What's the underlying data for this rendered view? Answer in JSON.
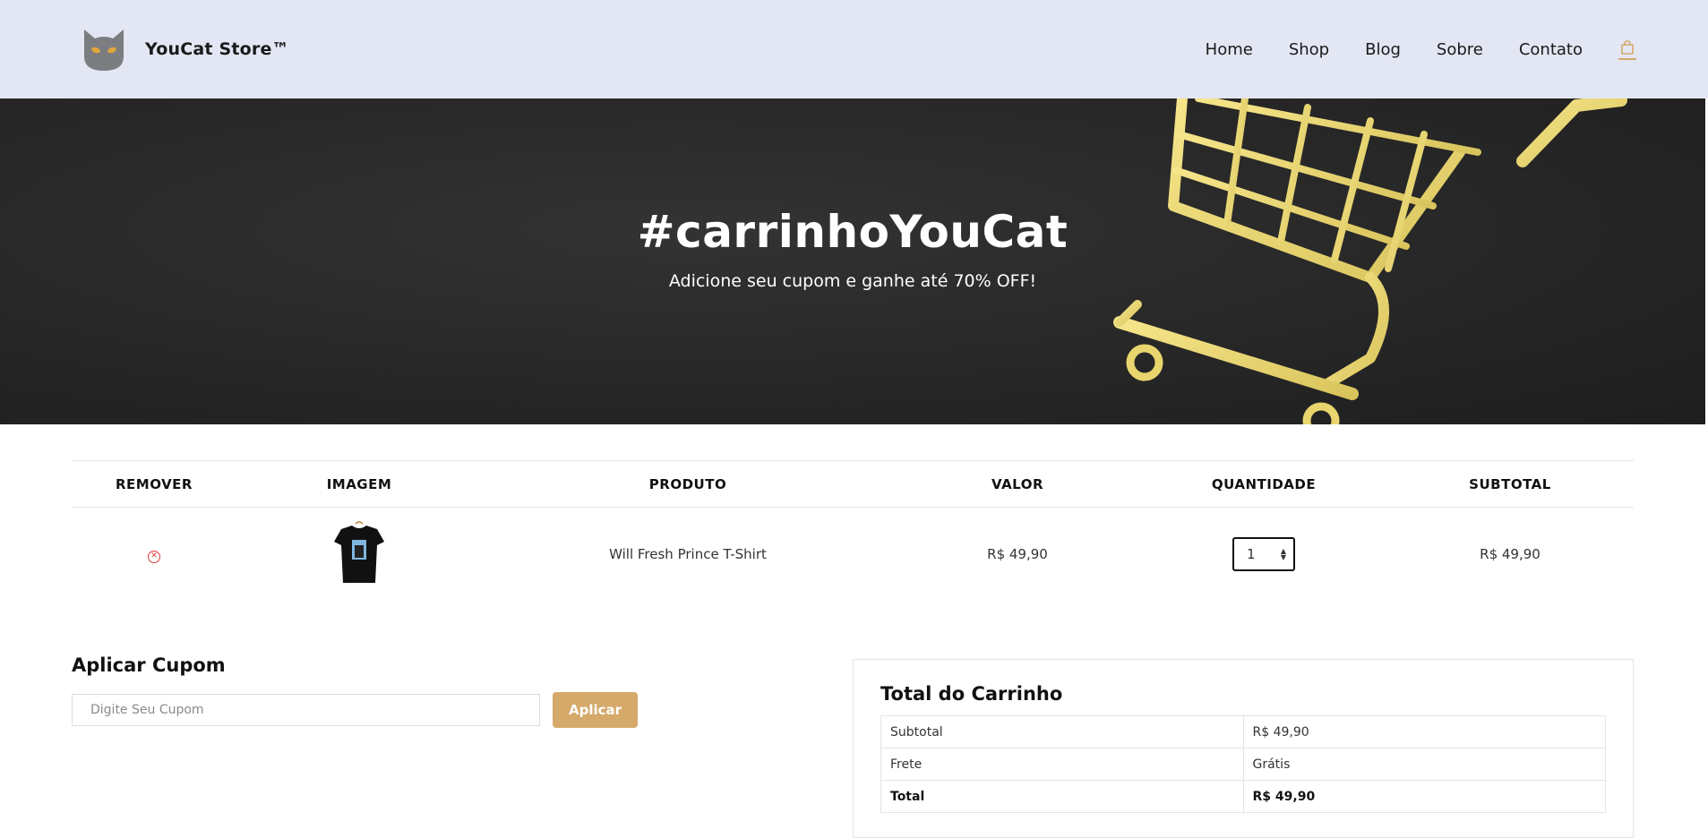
{
  "header": {
    "brand": "YouCat Store™",
    "nav": [
      "Home",
      "Shop",
      "Blog",
      "Sobre",
      "Contato"
    ],
    "cart_icon": "shopping-bag-icon",
    "accent_color": "#d4a96a"
  },
  "hero": {
    "title": "#carrinhoYouCat",
    "subtitle": "Adicione seu cupom e ganhe até 70% OFF!"
  },
  "cart": {
    "headers": [
      "REMOVER",
      "IMAGEM",
      "PRODUTO",
      "VALOR",
      "QUANTIDADE",
      "SUBTOTAL"
    ],
    "rows": [
      {
        "product": "Will Fresh Prince T-Shirt",
        "price": "R$ 49,90",
        "quantity": "1",
        "subtotal": "R$ 49,90"
      }
    ]
  },
  "coupon": {
    "title": "Aplicar Cupom",
    "placeholder": "Digite Seu Cupom",
    "button": "Aplicar"
  },
  "totals": {
    "title": "Total do Carrinho",
    "rows": [
      {
        "label": "Subtotal",
        "value": "R$ 49,90"
      },
      {
        "label": "Frete",
        "value": "Grátis"
      },
      {
        "label": "Total",
        "value": "R$ 49,90"
      }
    ]
  }
}
